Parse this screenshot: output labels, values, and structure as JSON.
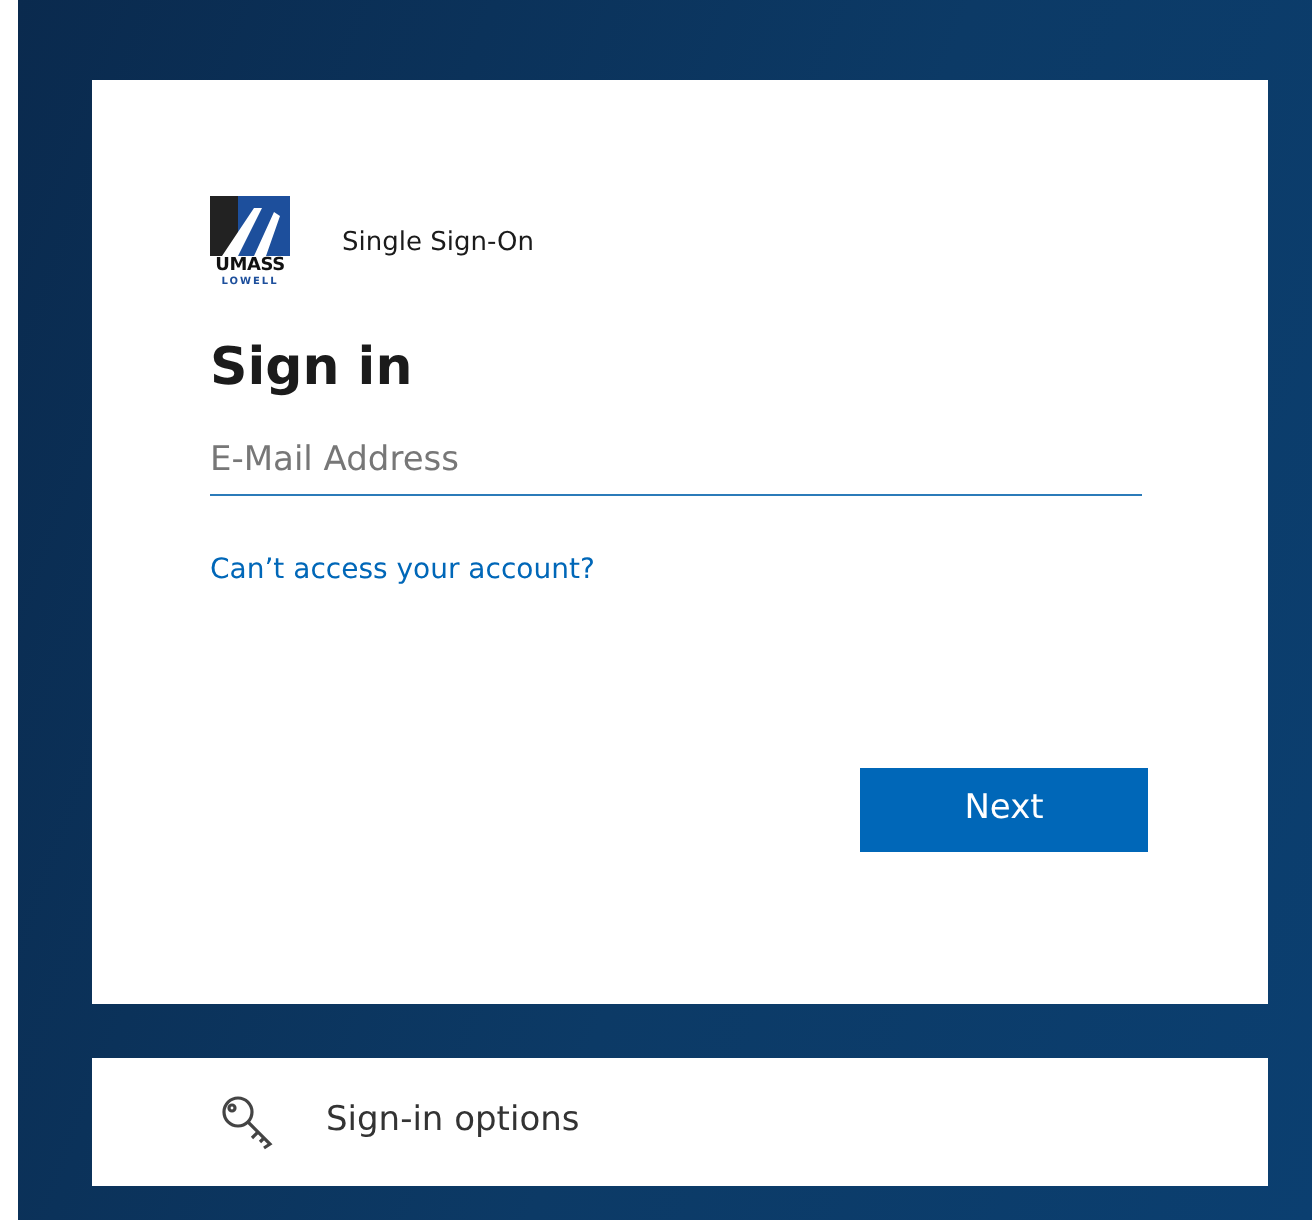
{
  "logo": {
    "line_1": "UMASS",
    "line_2": "LOWELL"
  },
  "header": "Single Sign-On",
  "title": "Sign in",
  "email_field": {
    "placeholder": "E-Mail Address"
  },
  "link": "Can’t access your account?",
  "next_button": "Next",
  "options": {
    "label": "Sign-in options"
  }
}
